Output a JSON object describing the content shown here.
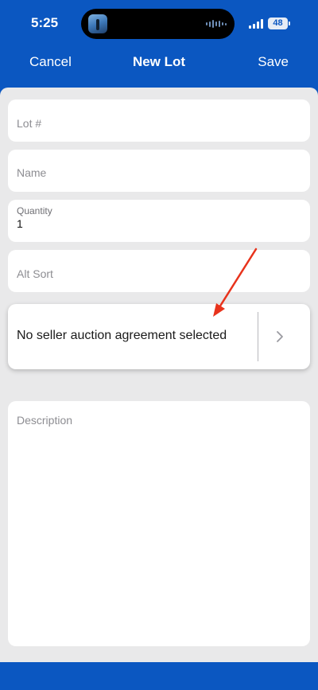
{
  "status_bar": {
    "time": "5:25",
    "battery": "48"
  },
  "nav": {
    "cancel_label": "Cancel",
    "title": "New Lot",
    "save_label": "Save"
  },
  "form": {
    "lot_number": {
      "placeholder": "Lot #"
    },
    "name": {
      "placeholder": "Name"
    },
    "quantity": {
      "label": "Quantity",
      "value": "1"
    },
    "alt_sort": {
      "placeholder": "Alt Sort"
    },
    "agreement": {
      "text": "No seller auction agreement selected"
    },
    "description": {
      "placeholder": "Description"
    }
  },
  "colors": {
    "brand_blue": "#0b57c1",
    "background": "#e9e9ea",
    "annotation_arrow": "#e8331c"
  },
  "icons": {
    "agreement_chevron": "chevron-right-icon"
  }
}
